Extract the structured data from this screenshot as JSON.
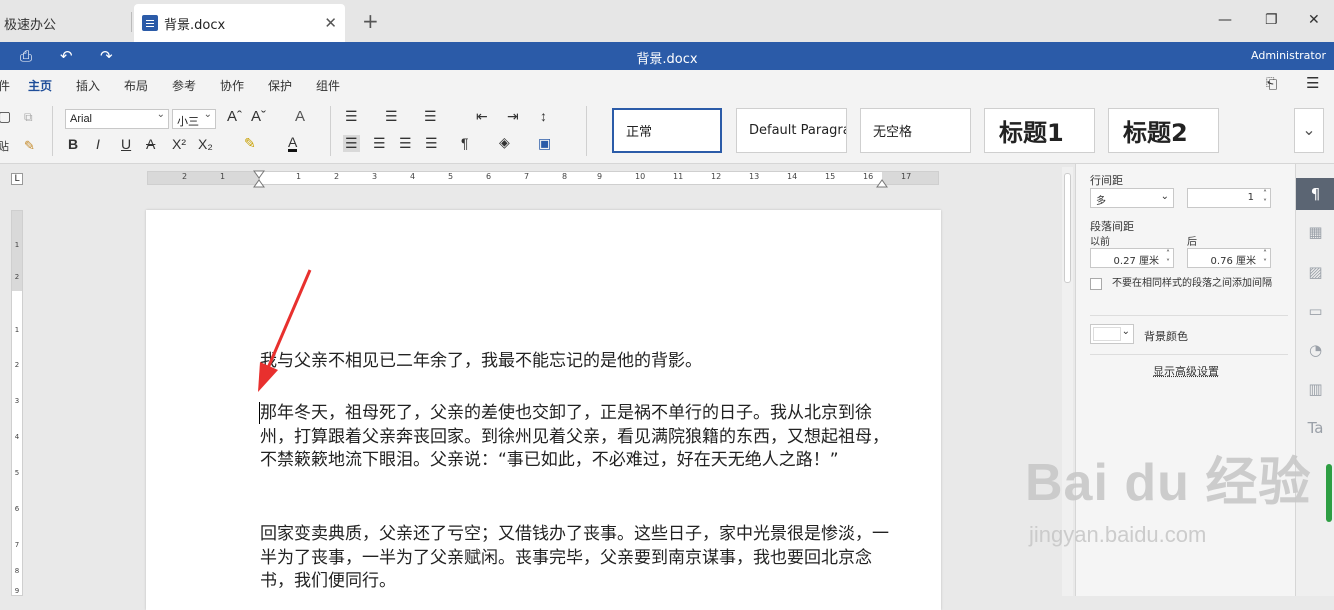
{
  "tabs": {
    "inactive_label": "极速办公",
    "active_label": "背景.docx",
    "close_symbol": "✕",
    "add_symbol": "+"
  },
  "titlebar": {
    "title": "背景.docx",
    "user": "Administrator"
  },
  "menu": [
    "件",
    "主页",
    "插入",
    "布局",
    "参考",
    "协作",
    "保护",
    "组件"
  ],
  "ribbon": {
    "font_name": "Arial",
    "font_size": "小三",
    "paste_label": "贴",
    "styles": [
      "正常",
      "Default Paragraph",
      "无空格",
      "标题1",
      "标题2"
    ]
  },
  "ruler": {
    "h_numbers": [
      "2",
      "1",
      "1",
      "2",
      "3",
      "4",
      "5",
      "6",
      "7",
      "8",
      "9",
      "10",
      "11",
      "12",
      "13",
      "14",
      "15",
      "16",
      "17"
    ],
    "v_numbers": [
      "1",
      "2",
      "1",
      "2",
      "3",
      "4",
      "5",
      "6",
      "7",
      "8",
      "9"
    ]
  },
  "document": {
    "paragraphs": [
      "我与父亲不相见已二年余了，我最不能忘记的是他的背影。",
      "那年冬天，祖母死了，父亲的差使也交卸了，正是祸不单行的日子。我从北京到徐州，打算跟着父亲奔丧回家。到徐州见着父亲，看见满院狼籍的东西，又想起祖母，不禁簌簌地流下眼泪。父亲说：“事已如此，不必难过，好在天无绝人之路！”",
      "回家变卖典质，父亲还了亏空；又借钱办了丧事。这些日子，家中光景很是惨淡，一半为了丧事，一半为了父亲赋闲。丧事完毕，父亲要到南京谋事，我也要回北京念书，我们便同行。"
    ]
  },
  "panel": {
    "line_spacing_label": "行间距",
    "line_spacing_type": "多",
    "line_spacing_value": "1",
    "para_spacing_label": "段落间距",
    "before_label": "以前",
    "after_label": "后",
    "before_value": "0.27 厘米",
    "after_value": "0.76 厘米",
    "no_space_same_style": "不要在相同样式的段落之间添加间隔",
    "bg_color_label": "背景颜色",
    "advanced_link": "显示高级设置"
  },
  "watermark": {
    "brand": "Bai du 经验",
    "url": "jingyan.baidu.com"
  },
  "colors": {
    "accent": "#2b5ba8",
    "arrow": "#e8302e"
  }
}
